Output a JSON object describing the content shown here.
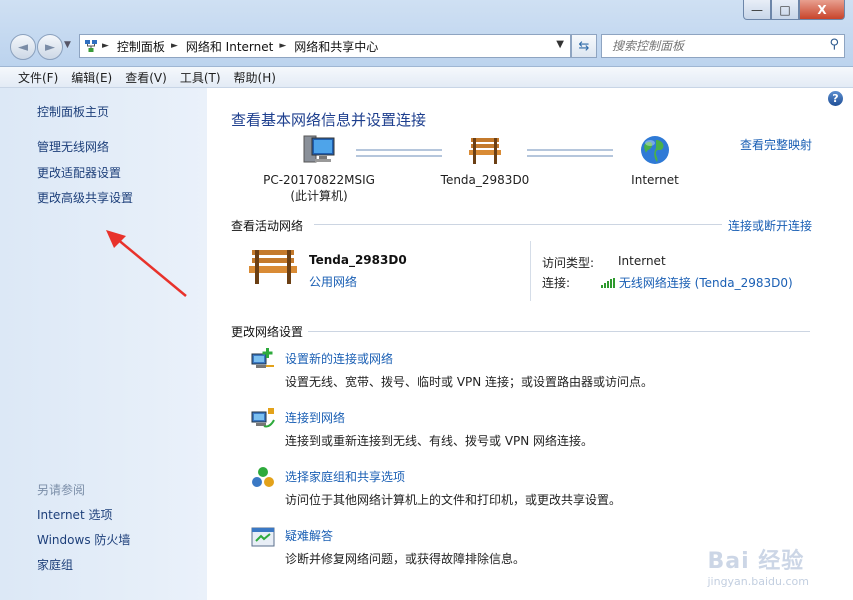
{
  "window": {
    "min_label": "—",
    "max_label": "□",
    "close_label": "X"
  },
  "nav": {
    "back_icon": "◄",
    "forward_icon": "►"
  },
  "address": {
    "crumbs": [
      "控制面板",
      "网络和 Internet",
      "网络和共享中心"
    ],
    "separator": "►",
    "dropdown_icon": "▼"
  },
  "search": {
    "placeholder": "搜索控制面板"
  },
  "menu": [
    "文件(F)",
    "编辑(E)",
    "查看(V)",
    "工具(T)",
    "帮助(H)"
  ],
  "sidebar": {
    "links": [
      "控制面板主页",
      "管理无线网络",
      "更改适配器设置",
      "更改高级共享设置"
    ],
    "see_also_label": "另请参阅",
    "see_also_links": [
      "Internet 选项",
      "Windows 防火墙",
      "家庭组"
    ]
  },
  "main": {
    "help_label": "?",
    "title": "查看基本网络信息并设置连接",
    "full_map_link": "查看完整映射",
    "nodes": [
      {
        "line1": "PC-20170822MSIG",
        "line2": "(此计算机)",
        "icon": "computer-icon"
      },
      {
        "line1": "Tenda_2983D0",
        "line2": "",
        "icon": "bench-icon"
      },
      {
        "line1": "Internet",
        "line2": "",
        "icon": "globe-icon"
      }
    ],
    "active_section": {
      "heading": "查看活动网络",
      "link": "连接或断开连接",
      "network_name": "Tenda_2983D0",
      "network_type": "公用网络",
      "access_type_label": "访问类型:",
      "access_type_value": "Internet",
      "connection_label": "连接:",
      "connection_value": "无线网络连接 (Tenda_2983D0)"
    },
    "change_section": {
      "heading": "更改网络设置",
      "tasks": [
        {
          "link": "设置新的连接或网络",
          "desc": "设置无线、宽带、拨号、临时或 VPN 连接；或设置路由器或访问点。"
        },
        {
          "link": "连接到网络",
          "desc": "连接到或重新连接到无线、有线、拨号或 VPN 网络连接。"
        },
        {
          "link": "选择家庭组和共享选项",
          "desc": "访问位于其他网络计算机上的文件和打印机，或更改共享设置。"
        },
        {
          "link": "疑难解答",
          "desc": "诊断并修复网络问题，或获得故障排除信息。"
        }
      ]
    }
  },
  "watermark": {
    "text": "Bai 经验",
    "sub": "jingyan.baidu.com"
  },
  "colors": {
    "link": "#1a5fb4",
    "title": "#1e3f8e",
    "sidebar_bg": "#dce8f6",
    "annotation_arrow": "#e8322b"
  }
}
